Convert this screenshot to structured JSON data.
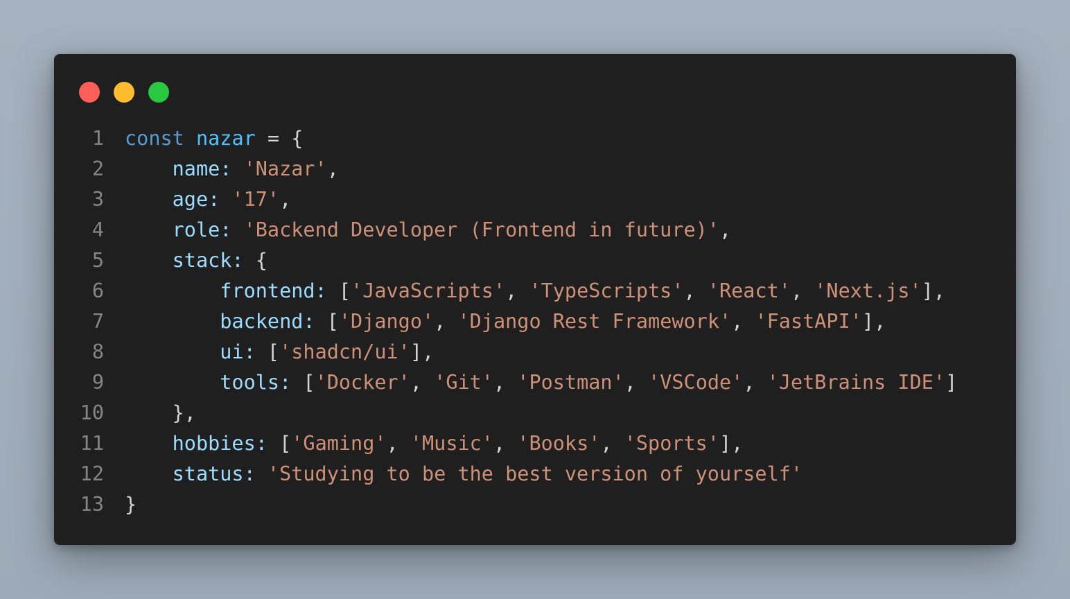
{
  "window": {
    "controls": [
      {
        "name": "close",
        "color": "#ff5f57"
      },
      {
        "name": "minimize",
        "color": "#febc2e"
      },
      {
        "name": "maximize",
        "color": "#28c840"
      }
    ]
  },
  "code": {
    "lines": [
      {
        "number": "1",
        "indent": "",
        "tokens": [
          {
            "text": "const",
            "type": "keyword"
          },
          {
            "text": " ",
            "type": "punc"
          },
          {
            "text": "nazar",
            "type": "var"
          },
          {
            "text": " = {",
            "type": "punc"
          }
        ]
      },
      {
        "number": "2",
        "indent": "    ",
        "tokens": [
          {
            "text": "name:",
            "type": "key"
          },
          {
            "text": " ",
            "type": "punc"
          },
          {
            "text": "'Nazar'",
            "type": "str"
          },
          {
            "text": ",",
            "type": "punc"
          }
        ]
      },
      {
        "number": "3",
        "indent": "    ",
        "tokens": [
          {
            "text": "age:",
            "type": "key"
          },
          {
            "text": " ",
            "type": "punc"
          },
          {
            "text": "'17'",
            "type": "str"
          },
          {
            "text": ",",
            "type": "punc"
          }
        ]
      },
      {
        "number": "4",
        "indent": "    ",
        "tokens": [
          {
            "text": "role:",
            "type": "key"
          },
          {
            "text": " ",
            "type": "punc"
          },
          {
            "text": "'Backend Developer (Frontend in future)'",
            "type": "str"
          },
          {
            "text": ",",
            "type": "punc"
          }
        ]
      },
      {
        "number": "5",
        "indent": "    ",
        "tokens": [
          {
            "text": "stack:",
            "type": "key"
          },
          {
            "text": " {",
            "type": "punc"
          }
        ]
      },
      {
        "number": "6",
        "indent": "        ",
        "tokens": [
          {
            "text": "frontend:",
            "type": "key"
          },
          {
            "text": " [",
            "type": "punc"
          },
          {
            "text": "'JavaScripts'",
            "type": "str"
          },
          {
            "text": ", ",
            "type": "punc"
          },
          {
            "text": "'TypeScripts'",
            "type": "str"
          },
          {
            "text": ", ",
            "type": "punc"
          },
          {
            "text": "'React'",
            "type": "str"
          },
          {
            "text": ", ",
            "type": "punc"
          },
          {
            "text": "'Next.js'",
            "type": "str"
          },
          {
            "text": "],",
            "type": "punc"
          }
        ]
      },
      {
        "number": "7",
        "indent": "        ",
        "tokens": [
          {
            "text": "backend:",
            "type": "key"
          },
          {
            "text": " [",
            "type": "punc"
          },
          {
            "text": "'Django'",
            "type": "str"
          },
          {
            "text": ", ",
            "type": "punc"
          },
          {
            "text": "'Django Rest Framework'",
            "type": "str"
          },
          {
            "text": ", ",
            "type": "punc"
          },
          {
            "text": "'FastAPI'",
            "type": "str"
          },
          {
            "text": "],",
            "type": "punc"
          }
        ]
      },
      {
        "number": "8",
        "indent": "        ",
        "tokens": [
          {
            "text": "ui:",
            "type": "key"
          },
          {
            "text": " [",
            "type": "punc"
          },
          {
            "text": "'shadcn/ui'",
            "type": "str"
          },
          {
            "text": "],",
            "type": "punc"
          }
        ]
      },
      {
        "number": "9",
        "indent": "        ",
        "tokens": [
          {
            "text": "tools:",
            "type": "key"
          },
          {
            "text": " [",
            "type": "punc"
          },
          {
            "text": "'Docker'",
            "type": "str"
          },
          {
            "text": ", ",
            "type": "punc"
          },
          {
            "text": "'Git'",
            "type": "str"
          },
          {
            "text": ", ",
            "type": "punc"
          },
          {
            "text": "'Postman'",
            "type": "str"
          },
          {
            "text": ", ",
            "type": "punc"
          },
          {
            "text": "'VSCode'",
            "type": "str"
          },
          {
            "text": ", ",
            "type": "punc"
          },
          {
            "text": "'JetBrains IDE'",
            "type": "str"
          },
          {
            "text": "]",
            "type": "punc"
          }
        ]
      },
      {
        "number": "10",
        "indent": "    ",
        "tokens": [
          {
            "text": "},",
            "type": "punc"
          }
        ]
      },
      {
        "number": "11",
        "indent": "    ",
        "tokens": [
          {
            "text": "hobbies:",
            "type": "key"
          },
          {
            "text": " [",
            "type": "punc"
          },
          {
            "text": "'Gaming'",
            "type": "str"
          },
          {
            "text": ", ",
            "type": "punc"
          },
          {
            "text": "'Music'",
            "type": "str"
          },
          {
            "text": ", ",
            "type": "punc"
          },
          {
            "text": "'Books'",
            "type": "str"
          },
          {
            "text": ", ",
            "type": "punc"
          },
          {
            "text": "'Sports'",
            "type": "str"
          },
          {
            "text": "],",
            "type": "punc"
          }
        ]
      },
      {
        "number": "12",
        "indent": "    ",
        "tokens": [
          {
            "text": "status:",
            "type": "key"
          },
          {
            "text": " ",
            "type": "punc"
          },
          {
            "text": "'Studying to be the best version of yourself'",
            "type": "str"
          }
        ]
      },
      {
        "number": "13",
        "indent": "",
        "tokens": [
          {
            "text": "}",
            "type": "punc"
          }
        ]
      }
    ]
  }
}
